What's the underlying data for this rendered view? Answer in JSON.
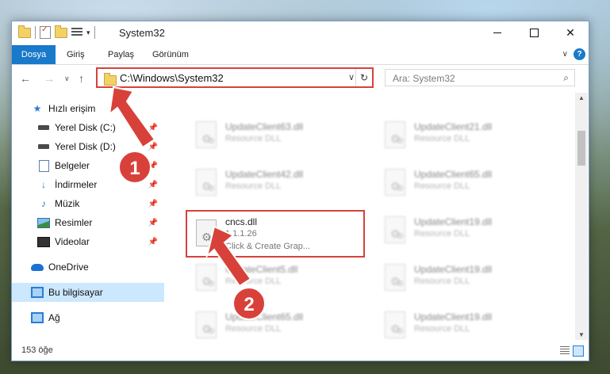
{
  "window": {
    "title": "System32",
    "minimize_label": "—",
    "close_label": "✕"
  },
  "ribbon": {
    "tabs": [
      "Dosya",
      "Giriş",
      "Paylaş",
      "Görünüm"
    ],
    "expand_label": "∨",
    "help_label": "?"
  },
  "navigation": {
    "back": "←",
    "forward": "→",
    "recent": "∨",
    "up": "↑"
  },
  "address": {
    "path": "C:\\Windows\\System32",
    "dropdown": "∨",
    "refresh": "↻"
  },
  "search": {
    "placeholder": "Ara: System32",
    "icon": "search-icon"
  },
  "sidebar": {
    "items": [
      {
        "label": "Hızlı erişim",
        "icon": "star-icon"
      },
      {
        "label": "Yerel Disk (C:)",
        "icon": "drive-icon",
        "pinned": true
      },
      {
        "label": "Yerel Disk (D:)",
        "icon": "drive-icon",
        "pinned": true
      },
      {
        "label": "Belgeler",
        "icon": "document-icon",
        "pinned": true
      },
      {
        "label": "İndirmeler",
        "icon": "download-icon",
        "pinned": true
      },
      {
        "label": "Müzik",
        "icon": "music-icon",
        "pinned": true
      },
      {
        "label": "Resimler",
        "icon": "pictures-icon",
        "pinned": true
      },
      {
        "label": "Videolar",
        "icon": "video-icon",
        "pinned": true
      },
      {
        "label": "OneDrive",
        "icon": "cloud-icon"
      },
      {
        "label": "Bu bilgisayar",
        "icon": "computer-icon",
        "selected": true
      },
      {
        "label": "Ağ",
        "icon": "network-icon"
      }
    ]
  },
  "files": {
    "left": [
      {
        "name": "UpdateClient63.dll",
        "type": "Resource DLL"
      },
      {
        "name": "UpdateClient42.dll",
        "type": "Resource DLL"
      },
      {
        "name": "cncs.dll",
        "type": "1.1.1.26",
        "desc": "Click & Create Grap..."
      },
      {
        "name": "UpdateClient5.dll",
        "type": "Resource DLL"
      },
      {
        "name": "UpdateClient65.dll",
        "type": "Resource DLL"
      }
    ],
    "right": [
      {
        "name": "UpdateClient21.dll",
        "type": "Resource DLL"
      },
      {
        "name": "UpdateClient65.dll",
        "type": "Resource DLL"
      },
      {
        "name": "UpdateClient19.dll",
        "type": "Resource DLL"
      },
      {
        "name": "UpdateClient19.dll",
        "type": "Resource DLL"
      },
      {
        "name": "UpdateClient19.dll",
        "type": "Resource DLL"
      }
    ]
  },
  "status": {
    "count": "153 öğe"
  },
  "annotations": {
    "step1": "1",
    "step2": "2",
    "highlight_color": "#d8413a"
  },
  "colors": {
    "accent": "#1979ca",
    "selection": "#cce8ff"
  }
}
